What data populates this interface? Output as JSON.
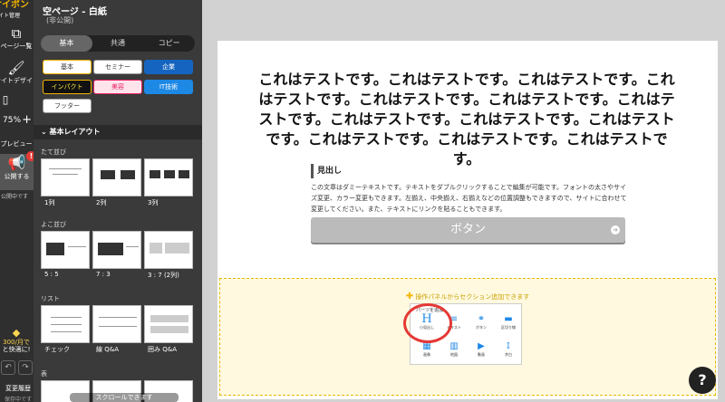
{
  "rail": {
    "logo": "サイポン",
    "logo_sub": "サイト管理",
    "pages_label": "ページ一覧",
    "design_label": "サイトデザイン",
    "zoom_value": "75%",
    "zoom_plus": "+",
    "preview_label": "プレビュー",
    "publish_label": "公開する",
    "publish_note": "公開中です",
    "notif_badge": "!",
    "upgrade_line1": "300/月で",
    "upgrade_line2": "と快適に!",
    "history_label": "変更履歴",
    "history_sub": "保存中です"
  },
  "panel": {
    "page_title": "空ページ - 白紙",
    "page_status": "(非公開)",
    "tabs": [
      {
        "label": "基本"
      },
      {
        "label": "共通"
      },
      {
        "label": "コピー"
      }
    ],
    "categories": [
      {
        "label": "基本",
        "bg": "#ffffff",
        "color": "#333333",
        "border": "#f4b400"
      },
      {
        "label": "セミナー",
        "bg": "#ffffff",
        "color": "#333333",
        "border": "#999999"
      },
      {
        "label": "企業",
        "bg": "#1565c0",
        "color": "#ffffff",
        "border": "#1565c0"
      },
      {
        "label": "インパクト",
        "bg": "#111111",
        "color": "#ffeb3b",
        "border": "#f4b400"
      },
      {
        "label": "美容",
        "bg": "#ffe4ec",
        "color": "#e91e63",
        "border": "#e91e63"
      },
      {
        "label": "IT技術",
        "bg": "#1e88e5",
        "color": "#ffffff",
        "border": "#1e88e5"
      },
      {
        "label": "フッター",
        "bg": "#ffffff",
        "color": "#333333",
        "border": "#999999"
      }
    ],
    "section_header": "基本レイアウト",
    "groups": [
      {
        "label": "たて並び",
        "items": [
          {
            "label": "1列"
          },
          {
            "label": "2列"
          },
          {
            "label": "3列"
          }
        ]
      },
      {
        "label": "よこ並び",
        "items": [
          {
            "label": "5 : 5"
          },
          {
            "label": "7 : 3"
          },
          {
            "label": "3 : 7 (2列)"
          }
        ]
      },
      {
        "label": "リスト",
        "items": [
          {
            "label": "チェック"
          },
          {
            "label": "線 Q&A"
          },
          {
            "label": "囲み Q&A"
          }
        ]
      },
      {
        "label": "表"
      }
    ],
    "scroll_hint": "スクロールできます"
  },
  "canvas": {
    "heading": "これはテストです。これはテストです。これはテストです。これはテストです。これはテストです。これはテストです。これはテストです。これはテストです。これはテストです。これはテストです。これはテストです。これはテストです。これはテストです。",
    "subheading": "見出し",
    "body": "この文章はダミーテキストです。テキストをダブルクリックすることで編集が可能です。フォントの太さやサイズ変更、カラー変更もできます。左揃え、中央揃え、右揃えなどの位置調整もできますので、サイトに合わせて変更してください。また、テキストにリンクを貼ることもできます。",
    "button_label": "ボタン",
    "add_section_hint": "操作パネルからセクション追加できます",
    "parts_title": "パーツを追加",
    "parts": [
      {
        "label": "小見出し",
        "icon": "H"
      },
      {
        "label": "テキスト",
        "icon": "≡"
      },
      {
        "label": "ボタン",
        "icon": "⚭"
      },
      {
        "label": "区切り線",
        "icon": "▬"
      },
      {
        "label": "画像",
        "icon": "▦"
      },
      {
        "label": "地図",
        "icon": "▥"
      },
      {
        "label": "動画",
        "icon": "▶"
      },
      {
        "label": "余白",
        "icon": "↕"
      }
    ]
  },
  "help_label": "?"
}
